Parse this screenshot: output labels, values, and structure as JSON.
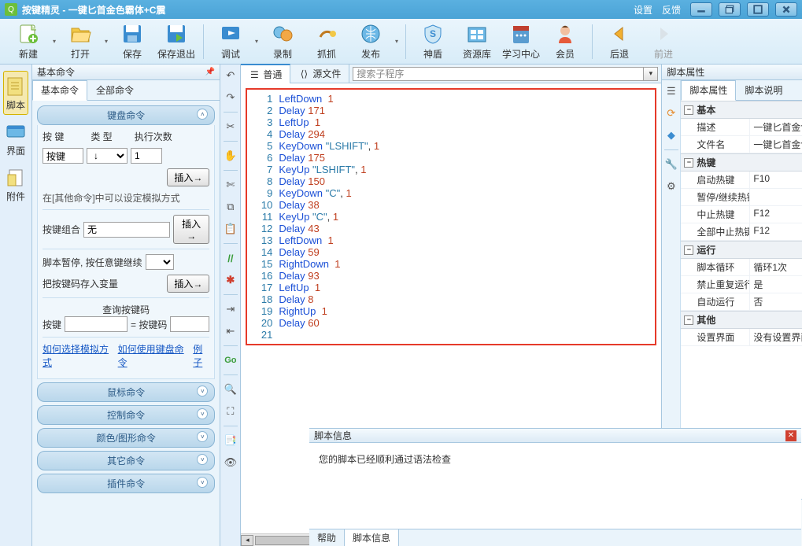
{
  "titlebar": {
    "app_name": "按键精灵",
    "doc_title": "一键匕首金色霸体+C震",
    "settings": "设置",
    "feedback": "反馈"
  },
  "toolbar": {
    "new": "新建",
    "open": "打开",
    "save": "保存",
    "save_exit": "保存退出",
    "debug": "调试",
    "record": "录制",
    "capture": "抓抓",
    "publish": "发布",
    "shield": "神盾",
    "resource": "资源库",
    "learn": "学习中心",
    "member": "会员",
    "back": "后退",
    "forward": "前进"
  },
  "leftnav": {
    "script": "脚本",
    "ui": "界面",
    "attach": "附件"
  },
  "panel": {
    "title": "基本命令",
    "tab_basic": "基本命令",
    "tab_all": "全部命令",
    "acc_keyboard": "键盘命令",
    "acc_mouse": "鼠标命令",
    "acc_control": "控制命令",
    "acc_color": "颜色/图形命令",
    "acc_other": "其它命令",
    "acc_plugin": "插件命令",
    "lbl_key": "按 键",
    "lbl_type": "类 型",
    "lbl_count": "执行次数",
    "combo_key": "按键",
    "combo_type": "↓",
    "count_val": "1",
    "insert": "插入→",
    "hint1": "在[其他命令]中可以设定模拟方式",
    "lbl_combo": "按键组合",
    "combo_none": "无",
    "lbl_pause": "脚本暂停, 按任意键继续",
    "lbl_savevar": "把按键码存入变量",
    "lbl_query": "查询按键码",
    "lbl_keyname": "按键",
    "lbl_keycode": "= 按键码",
    "link_sim": "如何选择模拟方式",
    "link_kb": "如何使用键盘命令",
    "link_ex": "例子"
  },
  "center": {
    "tab_normal": "普通",
    "tab_source": "源文件",
    "search_placeholder": "搜索子程序"
  },
  "code": [
    {
      "n": 1,
      "t": [
        {
          "c": "kw",
          "s": "LeftDown"
        },
        {
          "c": "",
          "s": "  "
        },
        {
          "c": "num",
          "s": "1"
        }
      ]
    },
    {
      "n": 2,
      "t": [
        {
          "c": "kw",
          "s": "Delay"
        },
        {
          "c": "",
          "s": " "
        },
        {
          "c": "num",
          "s": "171"
        }
      ]
    },
    {
      "n": 3,
      "t": [
        {
          "c": "kw",
          "s": "LeftUp"
        },
        {
          "c": "",
          "s": "  "
        },
        {
          "c": "num",
          "s": "1"
        }
      ]
    },
    {
      "n": 4,
      "t": [
        {
          "c": "kw",
          "s": "Delay"
        },
        {
          "c": "",
          "s": " "
        },
        {
          "c": "num",
          "s": "294"
        }
      ]
    },
    {
      "n": 5,
      "t": [
        {
          "c": "kw",
          "s": "KeyDown"
        },
        {
          "c": "",
          "s": " "
        },
        {
          "c": "str",
          "s": "\"LSHIFT\""
        },
        {
          "c": "",
          "s": ", "
        },
        {
          "c": "num",
          "s": "1"
        }
      ]
    },
    {
      "n": 6,
      "t": [
        {
          "c": "kw",
          "s": "Delay"
        },
        {
          "c": "",
          "s": " "
        },
        {
          "c": "num",
          "s": "175"
        }
      ]
    },
    {
      "n": 7,
      "t": [
        {
          "c": "kw",
          "s": "KeyUp"
        },
        {
          "c": "",
          "s": " "
        },
        {
          "c": "str",
          "s": "\"LSHIFT\""
        },
        {
          "c": "",
          "s": ", "
        },
        {
          "c": "num",
          "s": "1"
        }
      ]
    },
    {
      "n": 8,
      "t": [
        {
          "c": "kw",
          "s": "Delay"
        },
        {
          "c": "",
          "s": " "
        },
        {
          "c": "num",
          "s": "150"
        }
      ]
    },
    {
      "n": 9,
      "t": [
        {
          "c": "kw",
          "s": "KeyDown"
        },
        {
          "c": "",
          "s": " "
        },
        {
          "c": "str",
          "s": "\"C\""
        },
        {
          "c": "",
          "s": ", "
        },
        {
          "c": "num",
          "s": "1"
        }
      ]
    },
    {
      "n": 10,
      "t": [
        {
          "c": "kw",
          "s": "Delay"
        },
        {
          "c": "",
          "s": " "
        },
        {
          "c": "num",
          "s": "38"
        }
      ]
    },
    {
      "n": 11,
      "t": [
        {
          "c": "kw",
          "s": "KeyUp"
        },
        {
          "c": "",
          "s": " "
        },
        {
          "c": "str",
          "s": "\"C\""
        },
        {
          "c": "",
          "s": ", "
        },
        {
          "c": "num",
          "s": "1"
        }
      ]
    },
    {
      "n": 12,
      "t": [
        {
          "c": "kw",
          "s": "Delay"
        },
        {
          "c": "",
          "s": " "
        },
        {
          "c": "num",
          "s": "43"
        }
      ]
    },
    {
      "n": 13,
      "t": [
        {
          "c": "kw",
          "s": "LeftDown"
        },
        {
          "c": "",
          "s": "  "
        },
        {
          "c": "num",
          "s": "1"
        }
      ]
    },
    {
      "n": 14,
      "t": [
        {
          "c": "kw",
          "s": "Delay"
        },
        {
          "c": "",
          "s": " "
        },
        {
          "c": "num",
          "s": "59"
        }
      ]
    },
    {
      "n": 15,
      "t": [
        {
          "c": "kw",
          "s": "RightDown"
        },
        {
          "c": "",
          "s": "  "
        },
        {
          "c": "num",
          "s": "1"
        }
      ]
    },
    {
      "n": 16,
      "t": [
        {
          "c": "kw",
          "s": "Delay"
        },
        {
          "c": "",
          "s": " "
        },
        {
          "c": "num",
          "s": "93"
        }
      ]
    },
    {
      "n": 17,
      "t": [
        {
          "c": "kw",
          "s": "LeftUp"
        },
        {
          "c": "",
          "s": "  "
        },
        {
          "c": "num",
          "s": "1"
        }
      ]
    },
    {
      "n": 18,
      "t": [
        {
          "c": "kw",
          "s": "Delay"
        },
        {
          "c": "",
          "s": " "
        },
        {
          "c": "num",
          "s": "8"
        }
      ]
    },
    {
      "n": 19,
      "t": [
        {
          "c": "kw",
          "s": "RightUp"
        },
        {
          "c": "",
          "s": "  "
        },
        {
          "c": "num",
          "s": "1"
        }
      ]
    },
    {
      "n": 20,
      "t": [
        {
          "c": "kw",
          "s": "Delay"
        },
        {
          "c": "",
          "s": " "
        },
        {
          "c": "num",
          "s": "60"
        }
      ]
    },
    {
      "n": 21,
      "t": []
    }
  ],
  "props": {
    "title": "脚本属性",
    "tab_props": "脚本属性",
    "tab_desc": "脚本说明",
    "cats": [
      {
        "name": "基本",
        "rows": [
          {
            "k": "描述",
            "v": "一键匕首金色..."
          },
          {
            "k": "文件名",
            "v": "一键匕首金色..."
          }
        ]
      },
      {
        "name": "热键",
        "rows": [
          {
            "k": "启动热键",
            "v": "F10"
          },
          {
            "k": "暂停/继续热键",
            "v": ""
          },
          {
            "k": "中止热键",
            "v": "F12"
          },
          {
            "k": "全部中止热键",
            "v": "F12"
          }
        ]
      },
      {
        "name": "运行",
        "rows": [
          {
            "k": "脚本循环",
            "v": "循环1次"
          },
          {
            "k": "禁止重复运行",
            "v": "是"
          },
          {
            "k": "自动运行",
            "v": "否"
          }
        ]
      },
      {
        "name": "其他",
        "rows": [
          {
            "k": "设置界面",
            "v": "没有设置界面"
          }
        ]
      }
    ]
  },
  "bottom": {
    "title": "脚本信息",
    "msg": "您的脚本已经顺利通过语法检查",
    "tab_help": "帮助",
    "tab_info": "脚本信息"
  }
}
